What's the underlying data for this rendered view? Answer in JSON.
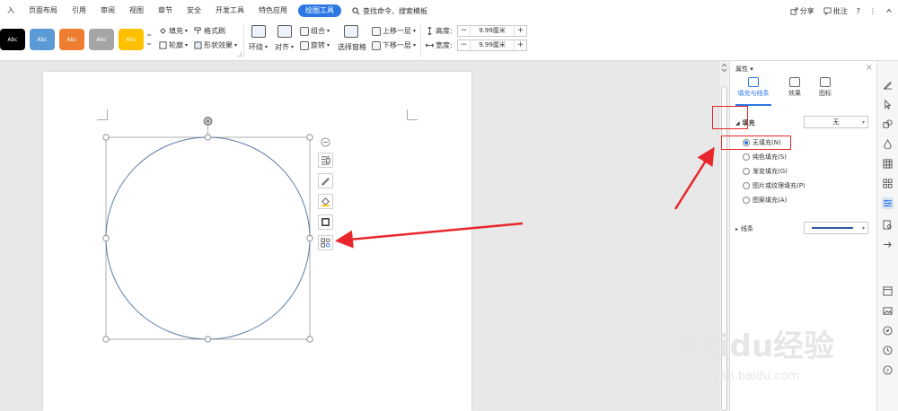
{
  "menubar": {
    "tabs": [
      "入",
      "页面布局",
      "引用",
      "审阅",
      "视图",
      "章节",
      "安全",
      "开发工具",
      "特色应用",
      "绘图工具"
    ],
    "active_tab": "绘图工具",
    "search_text": "查找命令、搜索模板",
    "share": "分享",
    "comment": "批注",
    "help": "?",
    "more": "⋮"
  },
  "ribbon": {
    "styles": [
      {
        "label": "Abc",
        "color": "#000000"
      },
      {
        "label": "Abc",
        "color": "#5b9bd5"
      },
      {
        "label": "Abc",
        "color": "#ed7d31"
      },
      {
        "label": "Abc",
        "color": "#a5a5a5"
      },
      {
        "label": "Abc",
        "color": "#ffc000"
      }
    ],
    "fill": "填充",
    "outline": "轮廓",
    "format_painter": "格式刷",
    "shape_effect": "形状效果",
    "wrap": "环绕",
    "align": "对齐",
    "group": "组合",
    "rotate": "旋转",
    "select_pane": "选择窗格",
    "bring_forward": "上移一层",
    "send_backward": "下移一层",
    "height_label": "高度:",
    "width_label": "宽度:",
    "height_value": "9.99厘米",
    "width_value": "9.99厘米",
    "minus": "−",
    "plus": "+"
  },
  "panel": {
    "title": "属性",
    "tabs": [
      "填充与线条",
      "效果",
      "图标"
    ],
    "fill_section": "填充",
    "fill_value": "无",
    "fill_options": [
      "无填充(N)",
      "纯色填充(S)",
      "渐变填充(G)",
      "图片或纹理填充(P)",
      "图案填充(A)"
    ],
    "selected_option": 0,
    "line_section": "线条"
  },
  "colors": {
    "accent": "#2b78e4",
    "circle_stroke": "#5b7ba8",
    "annotation_red": "#e8262b"
  },
  "watermark": {
    "brand": "Baidu经验",
    "url": "jingyan.baidu.com"
  }
}
